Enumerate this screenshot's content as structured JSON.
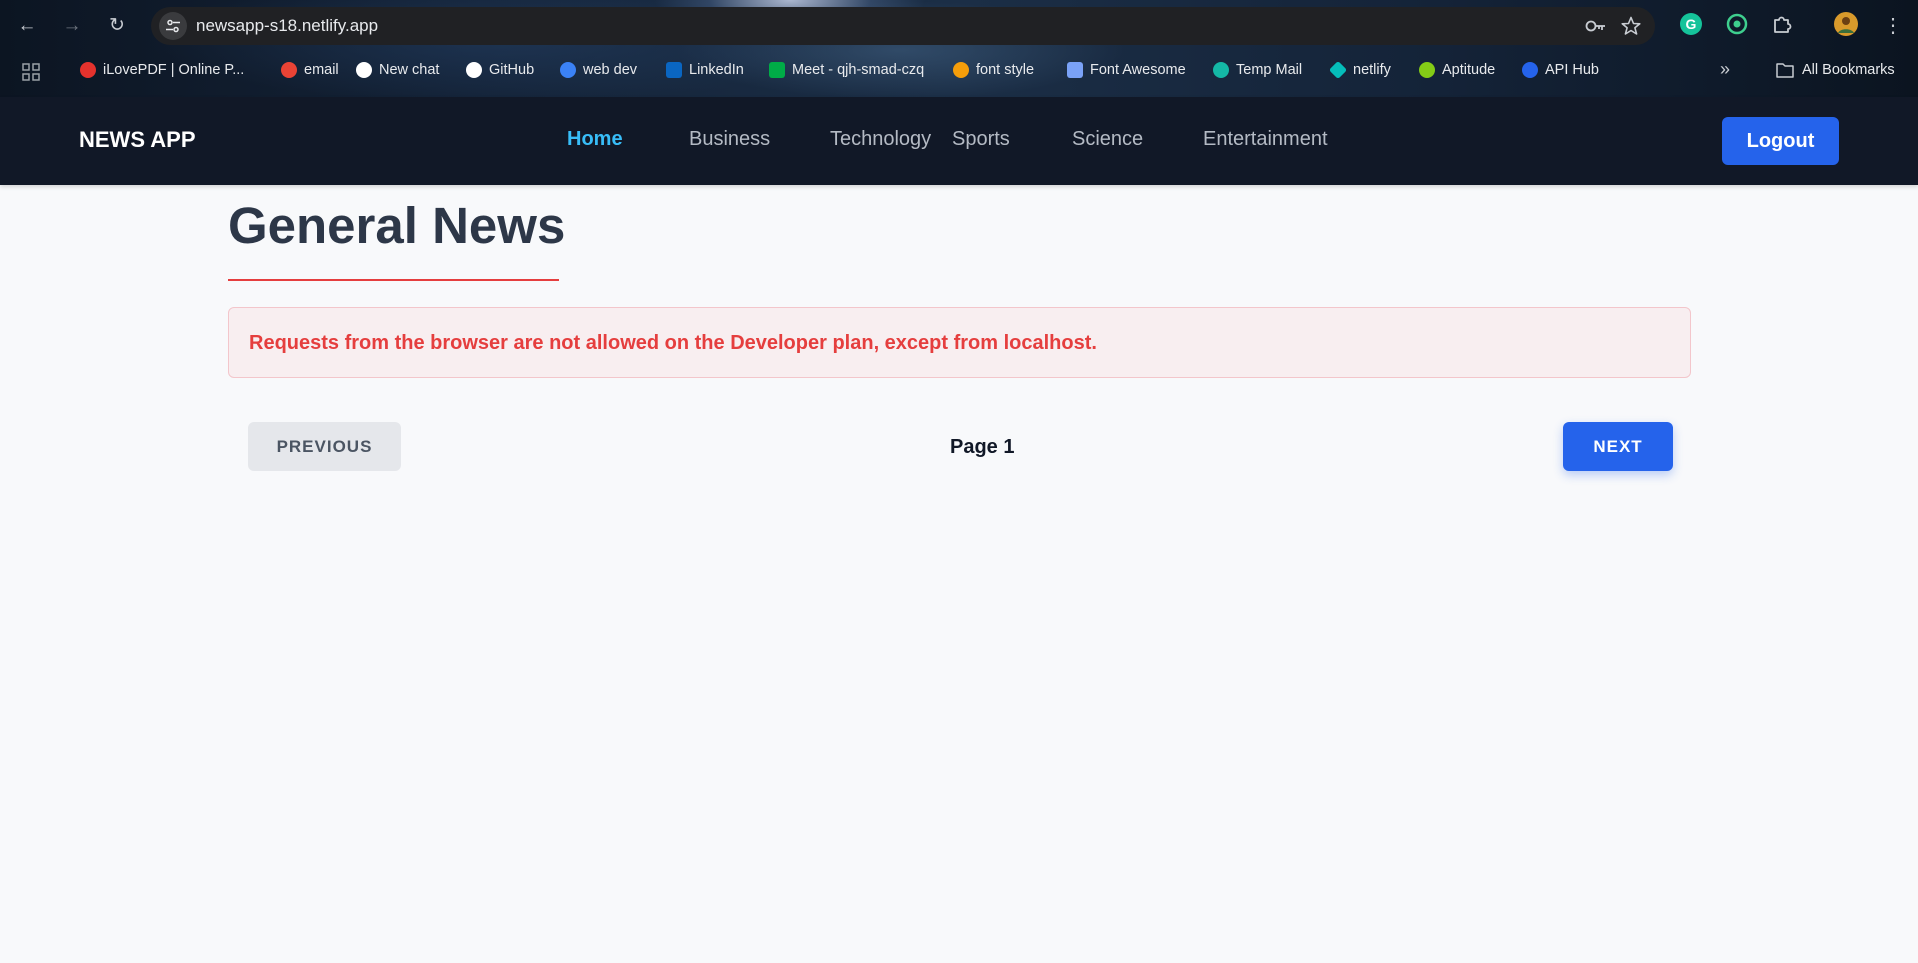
{
  "browser": {
    "url": "newsapp-s18.netlify.app",
    "bookmarks": [
      {
        "label": "iLovePDF | Online P...",
        "icon": "heart-icon",
        "color": "#e5322d"
      },
      {
        "label": "email",
        "icon": "gmail-icon",
        "color": "#ea4335"
      },
      {
        "label": "New chat",
        "icon": "chatgpt-icon",
        "color": "#ffffff"
      },
      {
        "label": "GitHub",
        "icon": "github-icon",
        "color": "#ffffff"
      },
      {
        "label": "web dev",
        "icon": "avatar-icon",
        "color": "#3b82f6"
      },
      {
        "label": "LinkedIn",
        "icon": "linkedin-icon",
        "color": "#0a66c2"
      },
      {
        "label": "Meet - qjh-smad-czq",
        "icon": "meet-icon",
        "color": "#00ac47"
      },
      {
        "label": "font style",
        "icon": "font-icon",
        "color": "#f59e0b"
      },
      {
        "label": "Font Awesome",
        "icon": "flag-icon",
        "color": "#7aa2f7"
      },
      {
        "label": "Temp Mail",
        "icon": "tempmail-icon",
        "color": "#14b8a6"
      },
      {
        "label": "netlify",
        "icon": "netlify-icon",
        "color": "#05bdba"
      },
      {
        "label": "Aptitude",
        "icon": "tree-icon",
        "color": "#84cc16"
      },
      {
        "label": "API Hub",
        "icon": "apihub-icon",
        "color": "#2563eb"
      }
    ],
    "all_bookmarks_label": "All Bookmarks"
  },
  "navbar": {
    "brand": "NEWS APP",
    "links": [
      "Home",
      "Business",
      "Technology",
      "Sports",
      "Science",
      "Entertainment"
    ],
    "active_link": "Home",
    "logout_label": "Logout"
  },
  "main": {
    "title": "General News",
    "error_message": "Requests from the browser are not allowed on the Developer plan, except from localhost.",
    "previous_label": "PREVIOUS",
    "page_label": "Page 1",
    "next_label": "NEXT"
  },
  "colors": {
    "navbar_bg": "#111827",
    "accent_blue": "#2563eb",
    "active_link": "#38bdf8",
    "error_red": "#e53e3e"
  }
}
